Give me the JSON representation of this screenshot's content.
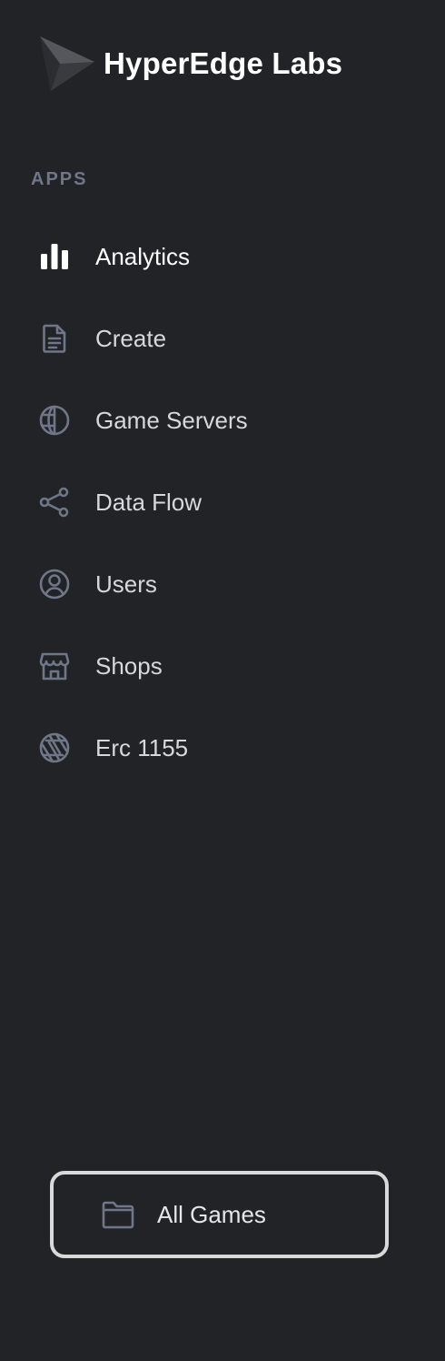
{
  "brand": {
    "name": "HyperEdge Labs",
    "logo": "triangle-logo"
  },
  "apps_section": {
    "label": "APPS"
  },
  "nav": {
    "items": [
      {
        "label": "Analytics",
        "icon": "bar-chart-icon",
        "active": true
      },
      {
        "label": "Create",
        "icon": "document-icon",
        "active": false
      },
      {
        "label": "Game Servers",
        "icon": "globe-icon",
        "active": false
      },
      {
        "label": "Data Flow",
        "icon": "share-icon",
        "active": false
      },
      {
        "label": "Users",
        "icon": "user-circle-icon",
        "active": false
      },
      {
        "label": "Shops",
        "icon": "store-icon",
        "active": false
      },
      {
        "label": "Erc 1155",
        "icon": "aperture-icon",
        "active": false
      }
    ]
  },
  "footer": {
    "all_games_label": "All Games",
    "icon": "folder-icon"
  },
  "colors": {
    "background": "#222327",
    "icon": "#6f7687",
    "active_icon": "#ffffff",
    "label": "#d6d8de",
    "section_label": "#6f7687",
    "button_border": "#d9d9d9"
  }
}
